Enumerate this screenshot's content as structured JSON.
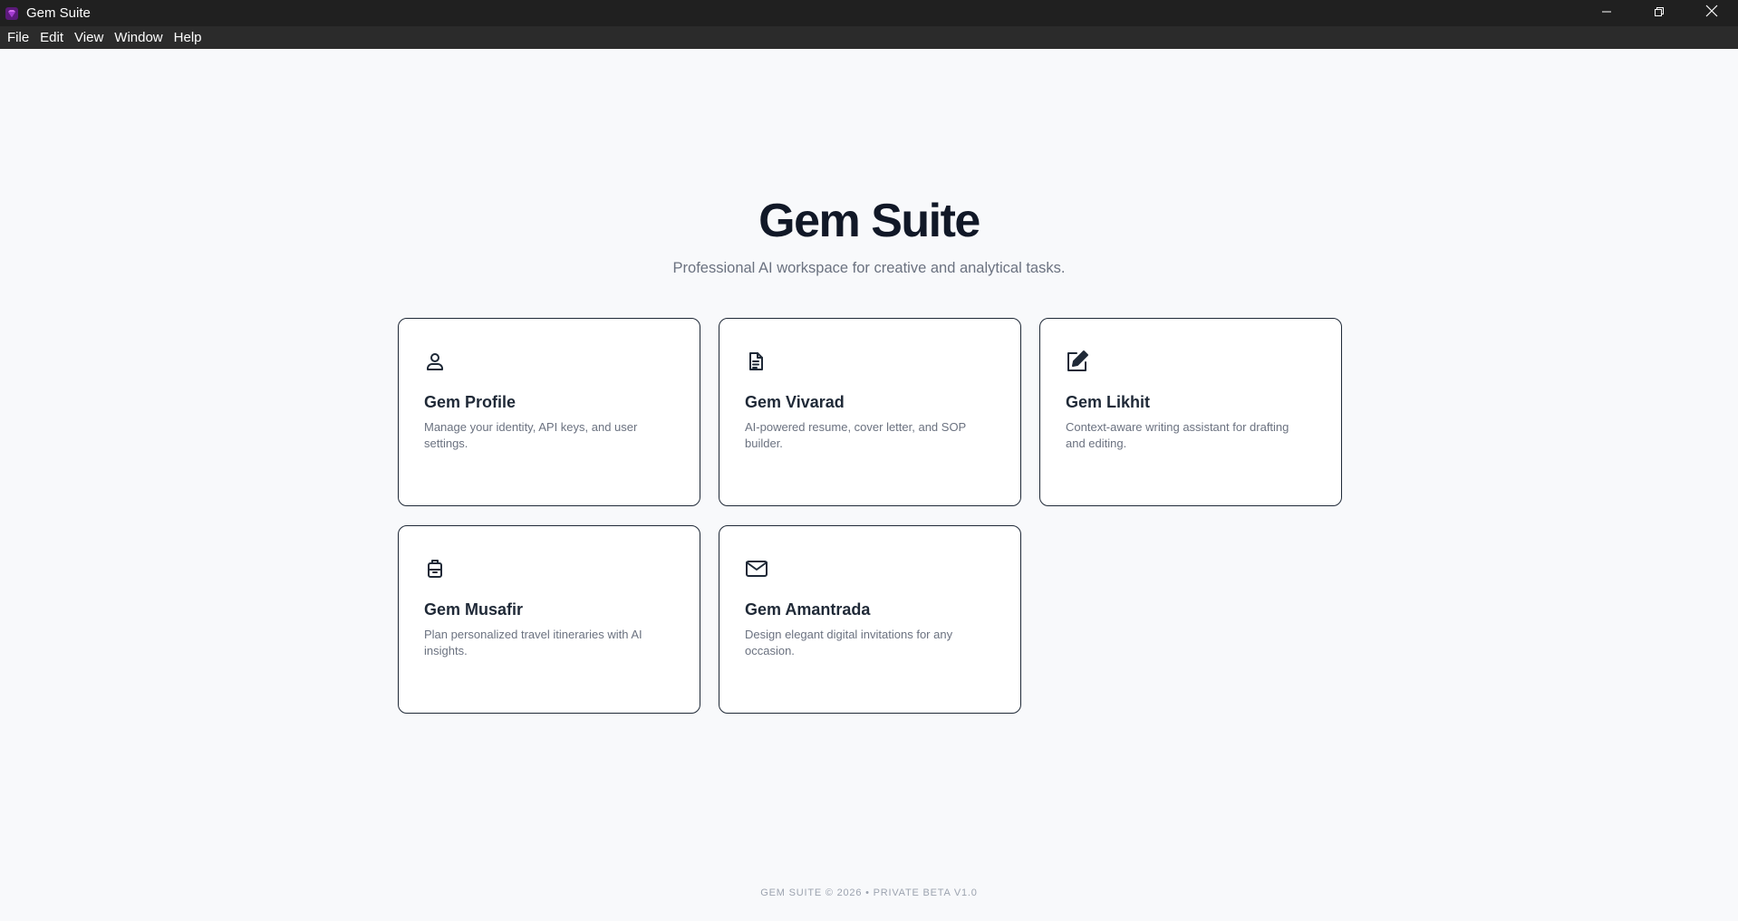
{
  "window": {
    "title": "Gem Suite",
    "minimize_icon": "minimize-icon",
    "maximize_icon": "restore-icon",
    "close_icon": "close-icon"
  },
  "menu": {
    "items": [
      "File",
      "Edit",
      "View",
      "Window",
      "Help"
    ]
  },
  "hero": {
    "title": "Gem Suite",
    "subtitle": "Professional AI workspace for creative and analytical tasks."
  },
  "cards": [
    {
      "title": "Gem Profile",
      "description": "Manage your identity, API keys, and user settings.",
      "icon": "user-icon"
    },
    {
      "title": "Gem Vivarad",
      "description": "AI-powered resume, cover letter, and SOP builder.",
      "icon": "document-icon"
    },
    {
      "title": "Gem Likhit",
      "description": "Context-aware writing assistant for drafting and editing.",
      "icon": "pen-edit-icon"
    },
    {
      "title": "Gem Musafir",
      "description": "Plan personalized travel itineraries with AI insights.",
      "icon": "luggage-icon"
    },
    {
      "title": "Gem Amantrada",
      "description": "Design elegant digital invitations for any occasion.",
      "icon": "envelope-icon"
    }
  ],
  "footer": {
    "text": "GEM SUITE © 2026 • PRIVATE BETA V1.0"
  },
  "colors": {
    "titlebar": "#202020",
    "menubar": "#2b2b2b",
    "background": "#f8f9fb",
    "card_border": "#1f2937",
    "heading": "#111827",
    "muted": "#6b7280",
    "app_icon": "#9b30c8"
  }
}
